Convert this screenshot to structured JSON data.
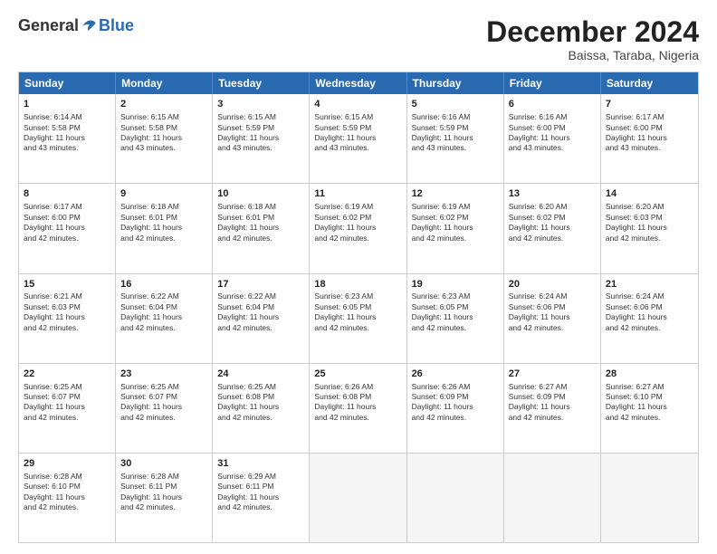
{
  "header": {
    "logo_general": "General",
    "logo_blue": "Blue",
    "month_title": "December 2024",
    "location": "Baissa, Taraba, Nigeria"
  },
  "days_of_week": [
    "Sunday",
    "Monday",
    "Tuesday",
    "Wednesday",
    "Thursday",
    "Friday",
    "Saturday"
  ],
  "weeks": [
    [
      {
        "day": "1",
        "lines": [
          "Sunrise: 6:14 AM",
          "Sunset: 5:58 PM",
          "Daylight: 11 hours",
          "and 43 minutes."
        ]
      },
      {
        "day": "2",
        "lines": [
          "Sunrise: 6:15 AM",
          "Sunset: 5:58 PM",
          "Daylight: 11 hours",
          "and 43 minutes."
        ]
      },
      {
        "day": "3",
        "lines": [
          "Sunrise: 6:15 AM",
          "Sunset: 5:59 PM",
          "Daylight: 11 hours",
          "and 43 minutes."
        ]
      },
      {
        "day": "4",
        "lines": [
          "Sunrise: 6:15 AM",
          "Sunset: 5:59 PM",
          "Daylight: 11 hours",
          "and 43 minutes."
        ]
      },
      {
        "day": "5",
        "lines": [
          "Sunrise: 6:16 AM",
          "Sunset: 5:59 PM",
          "Daylight: 11 hours",
          "and 43 minutes."
        ]
      },
      {
        "day": "6",
        "lines": [
          "Sunrise: 6:16 AM",
          "Sunset: 6:00 PM",
          "Daylight: 11 hours",
          "and 43 minutes."
        ]
      },
      {
        "day": "7",
        "lines": [
          "Sunrise: 6:17 AM",
          "Sunset: 6:00 PM",
          "Daylight: 11 hours",
          "and 43 minutes."
        ]
      }
    ],
    [
      {
        "day": "8",
        "lines": [
          "Sunrise: 6:17 AM",
          "Sunset: 6:00 PM",
          "Daylight: 11 hours",
          "and 42 minutes."
        ]
      },
      {
        "day": "9",
        "lines": [
          "Sunrise: 6:18 AM",
          "Sunset: 6:01 PM",
          "Daylight: 11 hours",
          "and 42 minutes."
        ]
      },
      {
        "day": "10",
        "lines": [
          "Sunrise: 6:18 AM",
          "Sunset: 6:01 PM",
          "Daylight: 11 hours",
          "and 42 minutes."
        ]
      },
      {
        "day": "11",
        "lines": [
          "Sunrise: 6:19 AM",
          "Sunset: 6:02 PM",
          "Daylight: 11 hours",
          "and 42 minutes."
        ]
      },
      {
        "day": "12",
        "lines": [
          "Sunrise: 6:19 AM",
          "Sunset: 6:02 PM",
          "Daylight: 11 hours",
          "and 42 minutes."
        ]
      },
      {
        "day": "13",
        "lines": [
          "Sunrise: 6:20 AM",
          "Sunset: 6:02 PM",
          "Daylight: 11 hours",
          "and 42 minutes."
        ]
      },
      {
        "day": "14",
        "lines": [
          "Sunrise: 6:20 AM",
          "Sunset: 6:03 PM",
          "Daylight: 11 hours",
          "and 42 minutes."
        ]
      }
    ],
    [
      {
        "day": "15",
        "lines": [
          "Sunrise: 6:21 AM",
          "Sunset: 6:03 PM",
          "Daylight: 11 hours",
          "and 42 minutes."
        ]
      },
      {
        "day": "16",
        "lines": [
          "Sunrise: 6:22 AM",
          "Sunset: 6:04 PM",
          "Daylight: 11 hours",
          "and 42 minutes."
        ]
      },
      {
        "day": "17",
        "lines": [
          "Sunrise: 6:22 AM",
          "Sunset: 6:04 PM",
          "Daylight: 11 hours",
          "and 42 minutes."
        ]
      },
      {
        "day": "18",
        "lines": [
          "Sunrise: 6:23 AM",
          "Sunset: 6:05 PM",
          "Daylight: 11 hours",
          "and 42 minutes."
        ]
      },
      {
        "day": "19",
        "lines": [
          "Sunrise: 6:23 AM",
          "Sunset: 6:05 PM",
          "Daylight: 11 hours",
          "and 42 minutes."
        ]
      },
      {
        "day": "20",
        "lines": [
          "Sunrise: 6:24 AM",
          "Sunset: 6:06 PM",
          "Daylight: 11 hours",
          "and 42 minutes."
        ]
      },
      {
        "day": "21",
        "lines": [
          "Sunrise: 6:24 AM",
          "Sunset: 6:06 PM",
          "Daylight: 11 hours",
          "and 42 minutes."
        ]
      }
    ],
    [
      {
        "day": "22",
        "lines": [
          "Sunrise: 6:25 AM",
          "Sunset: 6:07 PM",
          "Daylight: 11 hours",
          "and 42 minutes."
        ]
      },
      {
        "day": "23",
        "lines": [
          "Sunrise: 6:25 AM",
          "Sunset: 6:07 PM",
          "Daylight: 11 hours",
          "and 42 minutes."
        ]
      },
      {
        "day": "24",
        "lines": [
          "Sunrise: 6:25 AM",
          "Sunset: 6:08 PM",
          "Daylight: 11 hours",
          "and 42 minutes."
        ]
      },
      {
        "day": "25",
        "lines": [
          "Sunrise: 6:26 AM",
          "Sunset: 6:08 PM",
          "Daylight: 11 hours",
          "and 42 minutes."
        ]
      },
      {
        "day": "26",
        "lines": [
          "Sunrise: 6:26 AM",
          "Sunset: 6:09 PM",
          "Daylight: 11 hours",
          "and 42 minutes."
        ]
      },
      {
        "day": "27",
        "lines": [
          "Sunrise: 6:27 AM",
          "Sunset: 6:09 PM",
          "Daylight: 11 hours",
          "and 42 minutes."
        ]
      },
      {
        "day": "28",
        "lines": [
          "Sunrise: 6:27 AM",
          "Sunset: 6:10 PM",
          "Daylight: 11 hours",
          "and 42 minutes."
        ]
      }
    ],
    [
      {
        "day": "29",
        "lines": [
          "Sunrise: 6:28 AM",
          "Sunset: 6:10 PM",
          "Daylight: 11 hours",
          "and 42 minutes."
        ]
      },
      {
        "day": "30",
        "lines": [
          "Sunrise: 6:28 AM",
          "Sunset: 6:11 PM",
          "Daylight: 11 hours",
          "and 42 minutes."
        ]
      },
      {
        "day": "31",
        "lines": [
          "Sunrise: 6:29 AM",
          "Sunset: 6:11 PM",
          "Daylight: 11 hours",
          "and 42 minutes."
        ]
      },
      {
        "day": "",
        "lines": []
      },
      {
        "day": "",
        "lines": []
      },
      {
        "day": "",
        "lines": []
      },
      {
        "day": "",
        "lines": []
      }
    ]
  ]
}
